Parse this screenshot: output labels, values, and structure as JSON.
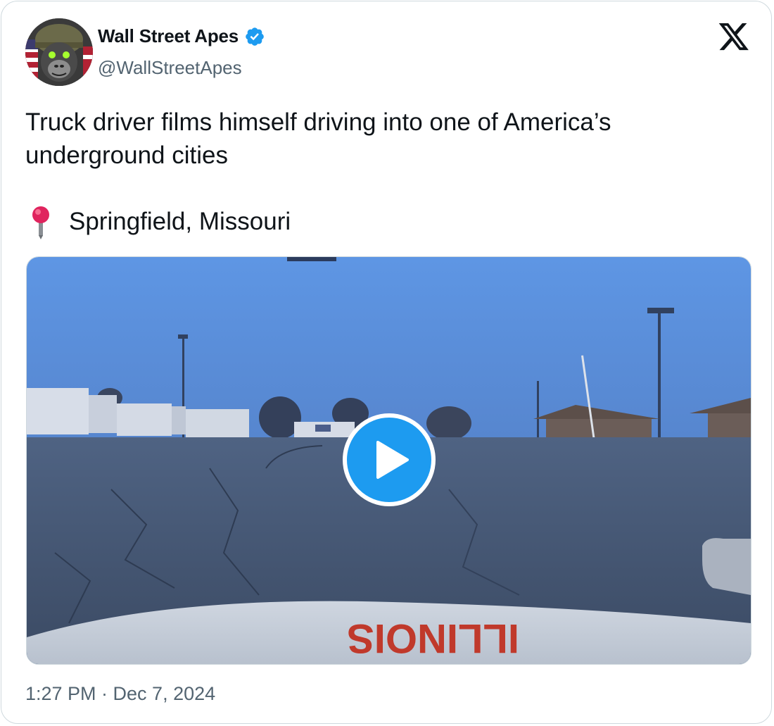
{
  "author": {
    "display_name": "Wall Street Apes",
    "handle": "@WallStreetApes",
    "avatar_icon": "gorilla-helmet-avatar",
    "verified_icon": "verified-badge-icon"
  },
  "platform_icon": "x-logo-icon",
  "tweet": {
    "text": "Truck driver films himself driving into one of America’s underground cities",
    "location_icon": "round-pushpin",
    "location_text": "Springfield, Missouri"
  },
  "media": {
    "type": "video",
    "play_icon": "play-icon",
    "hood_text": "ILLINOIS"
  },
  "timestamp": "1:27 PM · Dec 7, 2024",
  "colors": {
    "accent": "#1d9bf0",
    "text_primary": "#0f1419",
    "text_secondary": "#536471",
    "border": "#cfd9de"
  }
}
